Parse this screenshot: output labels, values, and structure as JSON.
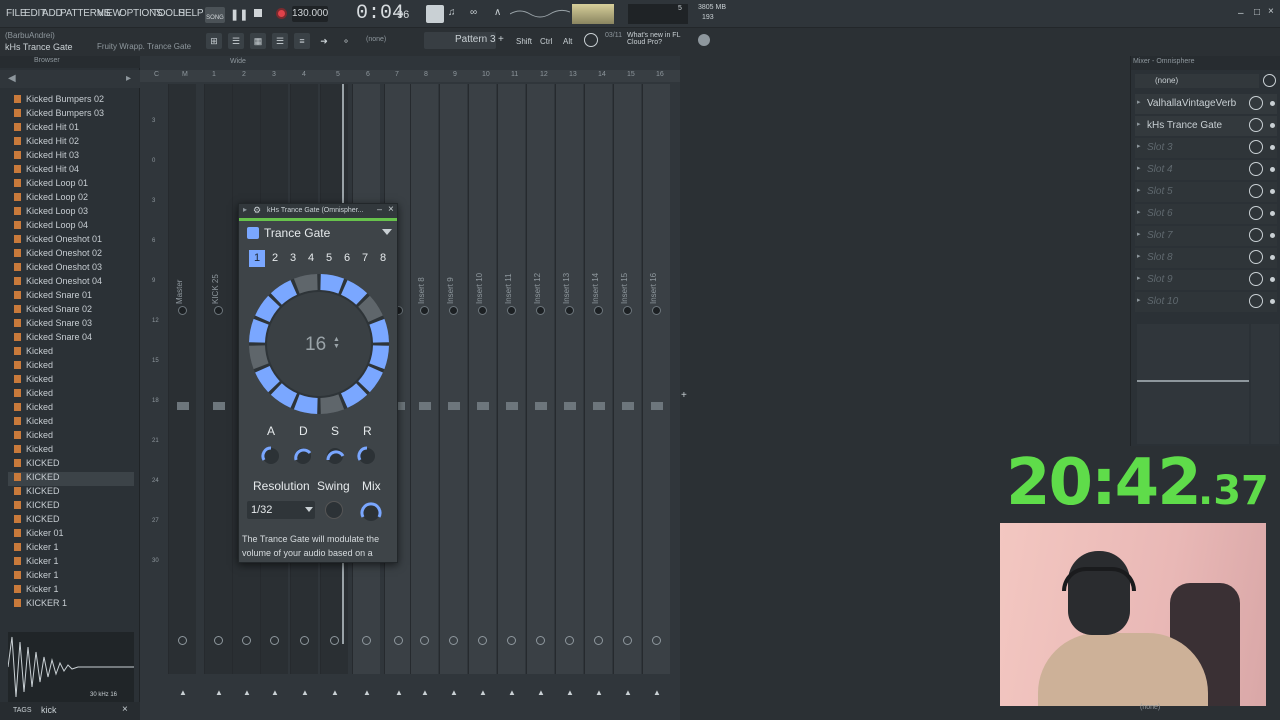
{
  "menu": {
    "items": [
      "FILE",
      "EDIT",
      "ADD",
      "PATTERNS",
      "VIEW",
      "OPTIONS",
      "TOOLS",
      "HELP"
    ]
  },
  "transport": {
    "mode": "SONG",
    "tempo": "130.000",
    "time": "0:04",
    "time_ms": "96",
    "cpu": "3805 MB",
    "cpu2": "193",
    "counter": "5"
  },
  "hint": {
    "user": "(BarbuAndrei)",
    "plugin_name": "kHs Trance Gate",
    "generator": "Fruity Wrapp. Trance Gate"
  },
  "toolbar": {
    "none_label": "(none)",
    "pattern": "Pattern 3",
    "shift": "Shift",
    "ctrl": "Ctrl",
    "alt": "Alt",
    "news_index": "03/11",
    "news_text": "What's new in FL Cloud Pro?"
  },
  "browser": {
    "title": "Browser",
    "items": [
      "Kicked Bumpers 02",
      "Kicked Bumpers 03",
      "Kicked Hit 01",
      "Kicked Hit 02",
      "Kicked Hit 03",
      "Kicked Hit 04",
      "Kicked Loop 01",
      "Kicked Loop 02",
      "Kicked Loop 03",
      "Kicked Loop 04",
      "Kicked Oneshot 01",
      "Kicked Oneshot 02",
      "Kicked Oneshot 03",
      "Kicked Oneshot 04",
      "Kicked Snare 01",
      "Kicked Snare 02",
      "Kicked Snare 03",
      "Kicked Snare 04",
      "Kicked",
      "Kicked",
      "Kicked",
      "Kicked",
      "Kicked",
      "Kicked",
      "Kicked",
      "Kicked",
      "KICKED",
      "KICKED",
      "KICKED",
      "KICKED",
      "KICKED",
      "Kicker 01",
      "Kicker 1",
      "Kicker 1",
      "Kicker 1",
      "Kicker 1",
      "KICKER 1"
    ],
    "selected_index": 27,
    "sample_info": "30 kHz 16",
    "tags_label": "TAGS",
    "search_value": "kick"
  },
  "mixer": {
    "wide": "Wide",
    "strip_labels": [
      "Master",
      "KICK 25",
      "",
      "",
      "",
      "",
      "",
      "",
      "Insert 8",
      "Insert 9",
      "Insert 10",
      "Insert 11",
      "Insert 12",
      "Insert 13",
      "Insert 14",
      "Insert 15",
      "Insert 16"
    ],
    "col_numbers": [
      "C",
      "M",
      "1",
      "2",
      "3",
      "4",
      "5",
      "6",
      "7",
      "8",
      "9",
      "10",
      "11",
      "12",
      "13",
      "14",
      "15",
      "16"
    ],
    "db_marks": [
      "3",
      "0",
      "3",
      "6",
      "9",
      "12",
      "15",
      "18",
      "21",
      "24",
      "27",
      "30"
    ]
  },
  "plugin": {
    "window_title": "kHs Trance Gate (Omnispher...",
    "preset": "Trance Gate",
    "patterns": [
      "1",
      "2",
      "3",
      "4",
      "5",
      "6",
      "7",
      "8"
    ],
    "active_pattern": "1",
    "steps": "16",
    "adsr": [
      "A",
      "D",
      "S",
      "R"
    ],
    "labels": {
      "resolution": "Resolution",
      "swing": "Swing",
      "mix": "Mix"
    },
    "resolution_value": "1/32",
    "description": "The Trance Gate will modulate the volume of your audio based on a"
  },
  "slots": {
    "title": "Mixer - Omnisphere",
    "none_label": "(none)",
    "items": [
      "ValhallaVintageVerb",
      "kHs Trance Gate",
      "Slot 3",
      "Slot 4",
      "Slot 5",
      "Slot 6",
      "Slot 7",
      "Slot 8",
      "Slot 9",
      "Slot 10"
    ],
    "bottom_none": "(none)"
  },
  "timer": {
    "main": "20:42",
    "fraction": ".37"
  },
  "colors": {
    "accent": "#7aa7ff",
    "timer_green": "#5fdc4a",
    "bg": "#2b3034"
  }
}
